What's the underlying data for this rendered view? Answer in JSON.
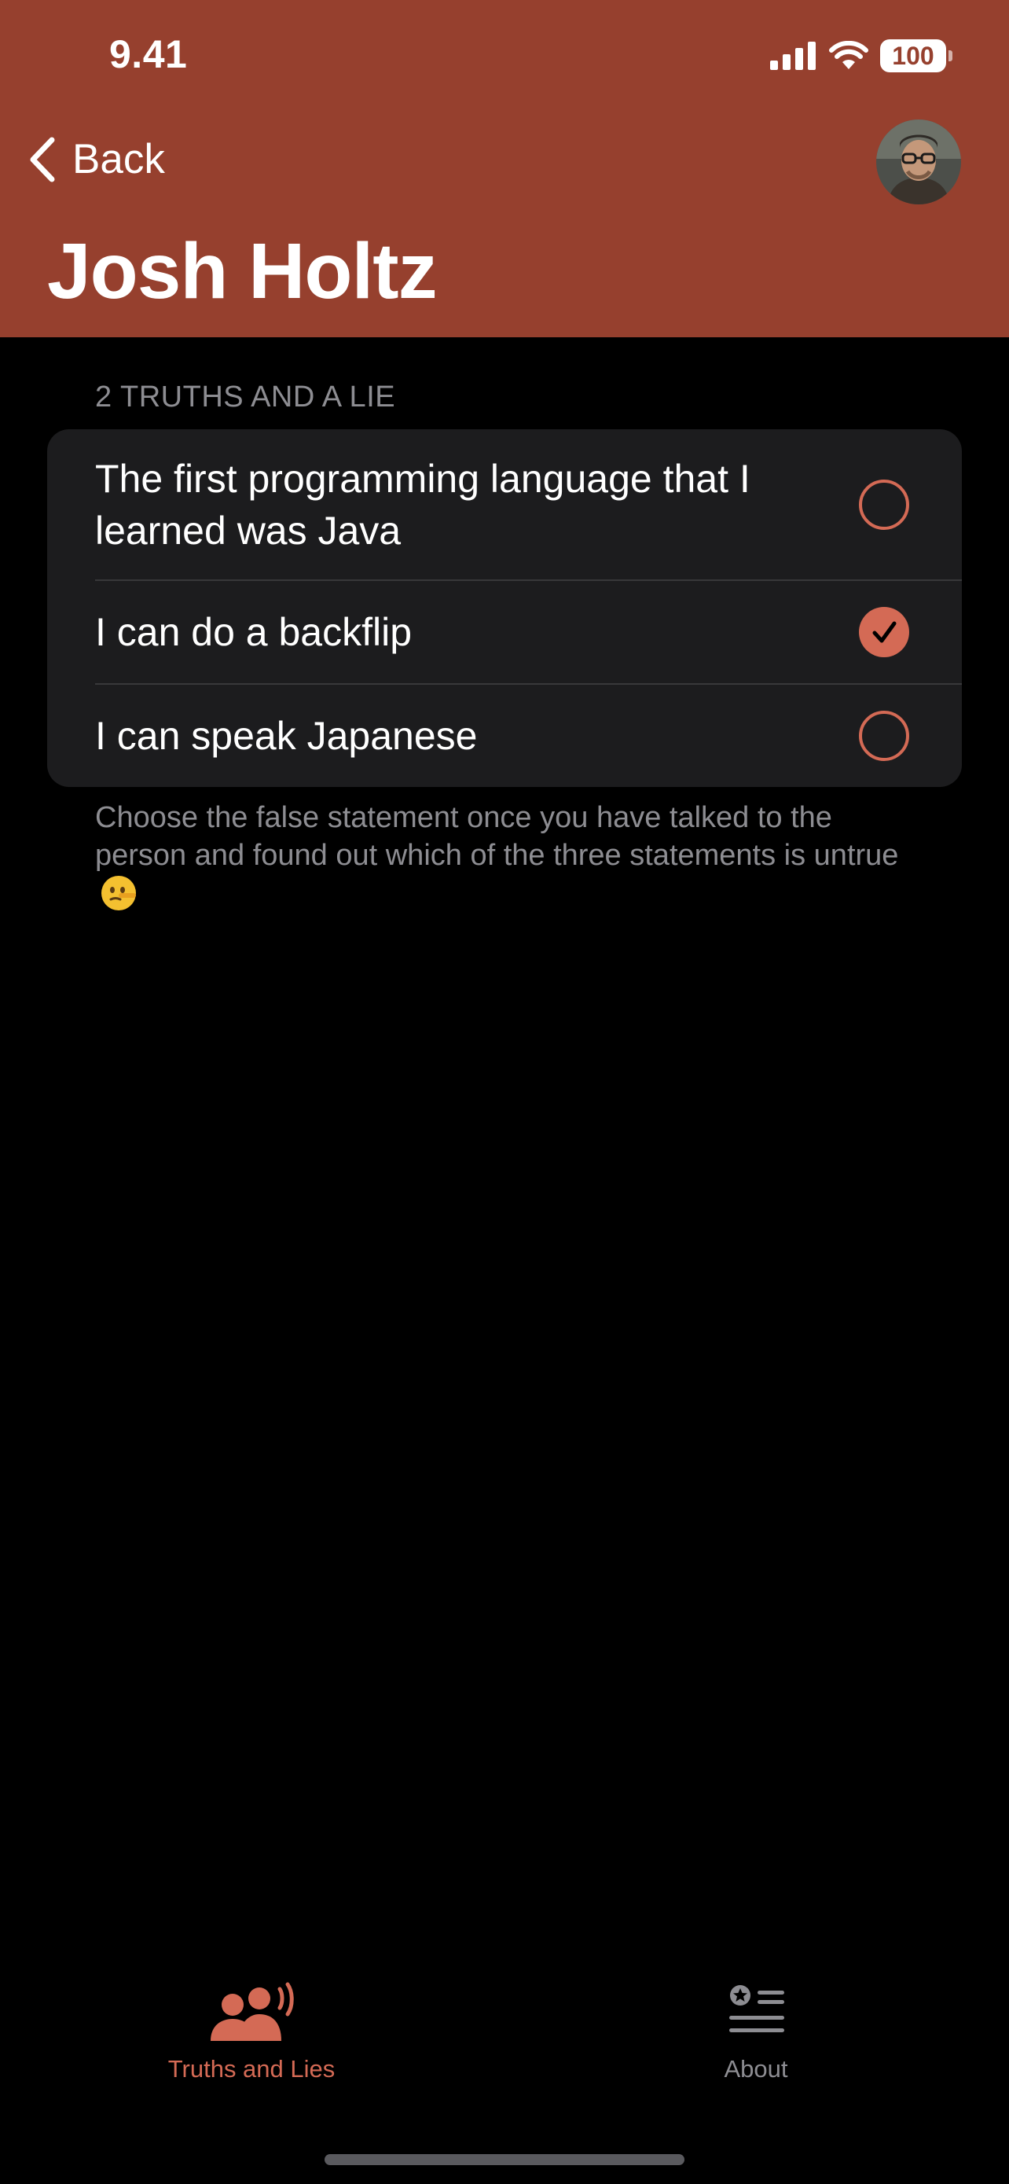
{
  "status_bar": {
    "time": "9.41",
    "battery": "100",
    "icons": [
      "cellular-signal-icon",
      "wifi-icon",
      "battery-icon"
    ]
  },
  "nav": {
    "back_label": "Back",
    "title": "Josh Holtz",
    "avatar_icon": "profile-photo"
  },
  "section": {
    "header": "2 TRUTHS AND A LIE",
    "statements": [
      {
        "text": "The first programming language that I learned was Java",
        "selected": false
      },
      {
        "text": "I can do a backflip",
        "selected": true
      },
      {
        "text": "I can speak Japanese",
        "selected": false
      }
    ],
    "footer": "Choose the false statement once you have talked to the person and found out which of the three statements is untrue",
    "footer_emoji": "🤥"
  },
  "tabs": [
    {
      "label": "Truths and Lies",
      "icon": "people-speaking-icon",
      "active": true
    },
    {
      "label": "About",
      "icon": "list-star-icon",
      "active": false
    }
  ],
  "colors": {
    "accent": "#96402E",
    "tint": "#D46A55",
    "background": "#000000",
    "card": "#1C1C1E",
    "secondary_text": "#8D8D92",
    "inactive_tab": "#8D8D92"
  }
}
